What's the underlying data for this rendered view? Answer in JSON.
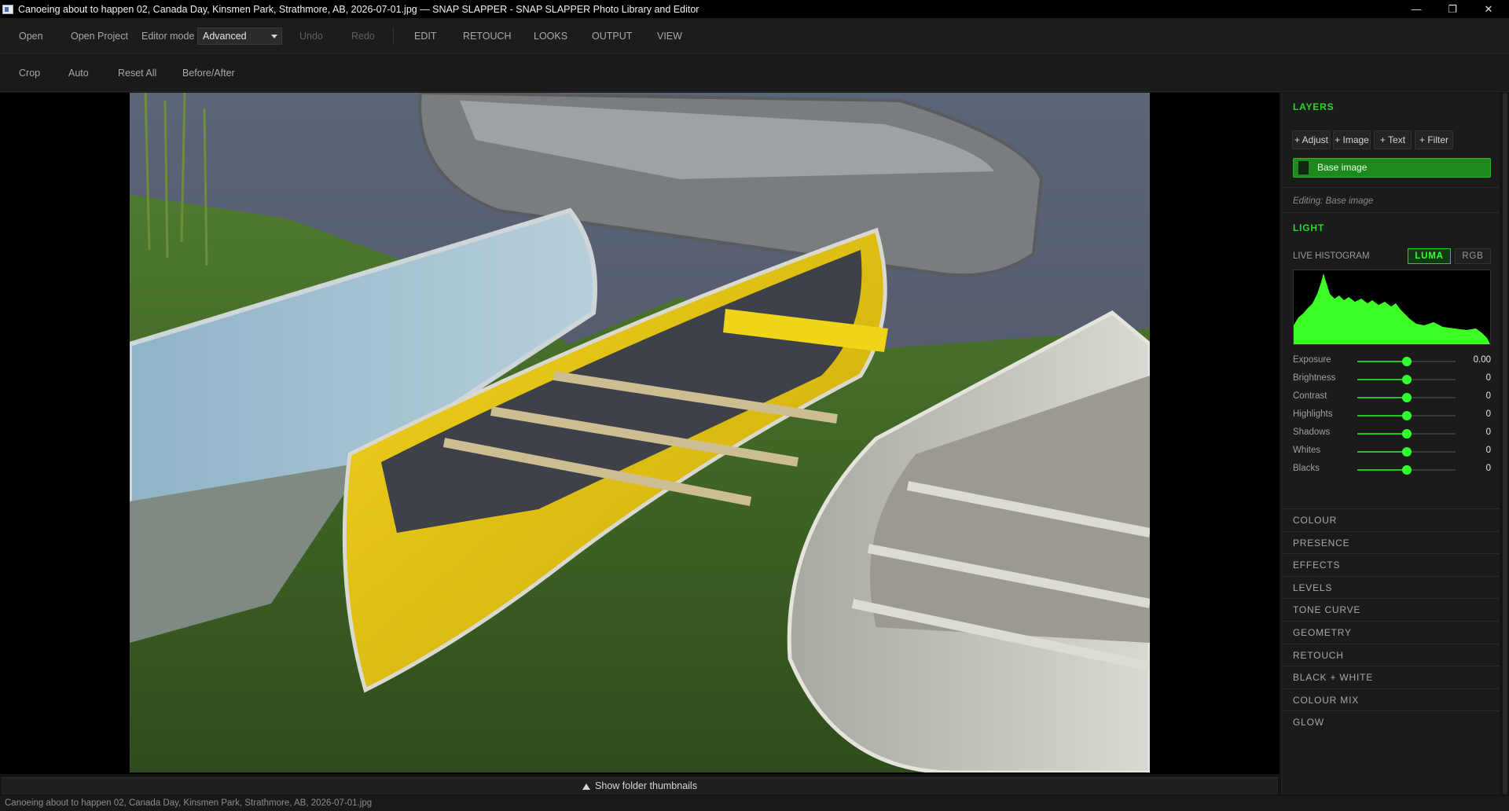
{
  "window": {
    "title": "Canoeing about to happen 02, Canada Day, Kinsmen Park, Strathmore, AB, 2026-07-01.jpg — SNAP SLAPPER - SNAP SLAPPER Photo Library and Editor",
    "minimize": "—",
    "restore": "❐",
    "close": "✕"
  },
  "menu": {
    "open": "Open",
    "open_project": "Open Project",
    "editor_mode_label": "Editor mode",
    "editor_mode_value": "Advanced",
    "undo": "Undo",
    "redo": "Redo",
    "edit": "EDIT",
    "retouch": "RETOUCH",
    "looks": "LOOKS",
    "output": "OUTPUT",
    "view": "VIEW"
  },
  "toolbar": {
    "crop": "Crop",
    "auto": "Auto",
    "reset_all": "Reset All",
    "before_after": "Before/After"
  },
  "layers": {
    "title": "LAYERS",
    "add_adjust": "+ Adjust",
    "add_image": "+ Image",
    "add_text": "+ Text",
    "add_filter": "+ Filter",
    "base_layer": "Base image",
    "editing": "Editing: Base image"
  },
  "light": {
    "title": "LIGHT",
    "histogram_label": "LIVE HISTOGRAM",
    "luma": "LUMA",
    "rgb": "RGB",
    "histogram_mode": "luma",
    "sliders": [
      {
        "label": "Exposure",
        "value": "0.00",
        "level": 0.5
      },
      {
        "label": "Brightness",
        "value": "0",
        "level": 0.5
      },
      {
        "label": "Contrast",
        "value": "0",
        "level": 0.5
      },
      {
        "label": "Highlights",
        "value": "0",
        "level": 0.5
      },
      {
        "label": "Shadows",
        "value": "0",
        "level": 0.5
      },
      {
        "label": "Whites",
        "value": "0",
        "level": 0.5
      },
      {
        "label": "Blacks",
        "value": "0",
        "level": 0.5
      }
    ]
  },
  "categories": [
    "COLOUR",
    "PRESENCE",
    "EFFECTS",
    "LEVELS",
    "TONE CURVE",
    "GEOMETRY",
    "RETOUCH",
    "BLACK + WHITE",
    "COLOUR MIX",
    "GLOW"
  ],
  "footer": {
    "show_thumbnails": "Show folder thumbnails",
    "status": "Canoeing about to happen 02, Canada Day, Kinsmen Park, Strathmore, AB, 2026-07-01.jpg"
  },
  "colors": {
    "accent": "#27d827",
    "panel_bg": "#1b1b1b",
    "histogram_fill": "#3cff24"
  }
}
